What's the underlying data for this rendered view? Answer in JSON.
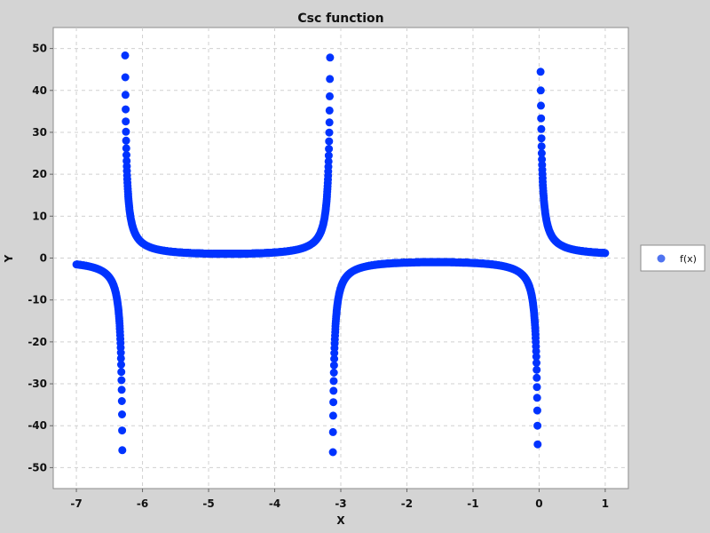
{
  "chart_data": {
    "type": "scatter",
    "title": "Csc function",
    "xlabel": "X",
    "ylabel": "Y",
    "xlim": [
      -7.35,
      1.35
    ],
    "ylim": [
      -55,
      55
    ],
    "x_ticks": [
      -7,
      -6,
      -5,
      -4,
      -3,
      -2,
      -1,
      0,
      1
    ],
    "y_ticks": [
      -50,
      -40,
      -30,
      -20,
      -10,
      0,
      10,
      20,
      30,
      40,
      50
    ],
    "grid": true,
    "legend_position": "right",
    "series": [
      {
        "name": "f(x)",
        "function": "csc(x)",
        "x_range": [
          -7,
          1
        ],
        "y_clip": [
          -50,
          50
        ],
        "color": "#0033ff"
      }
    ]
  }
}
